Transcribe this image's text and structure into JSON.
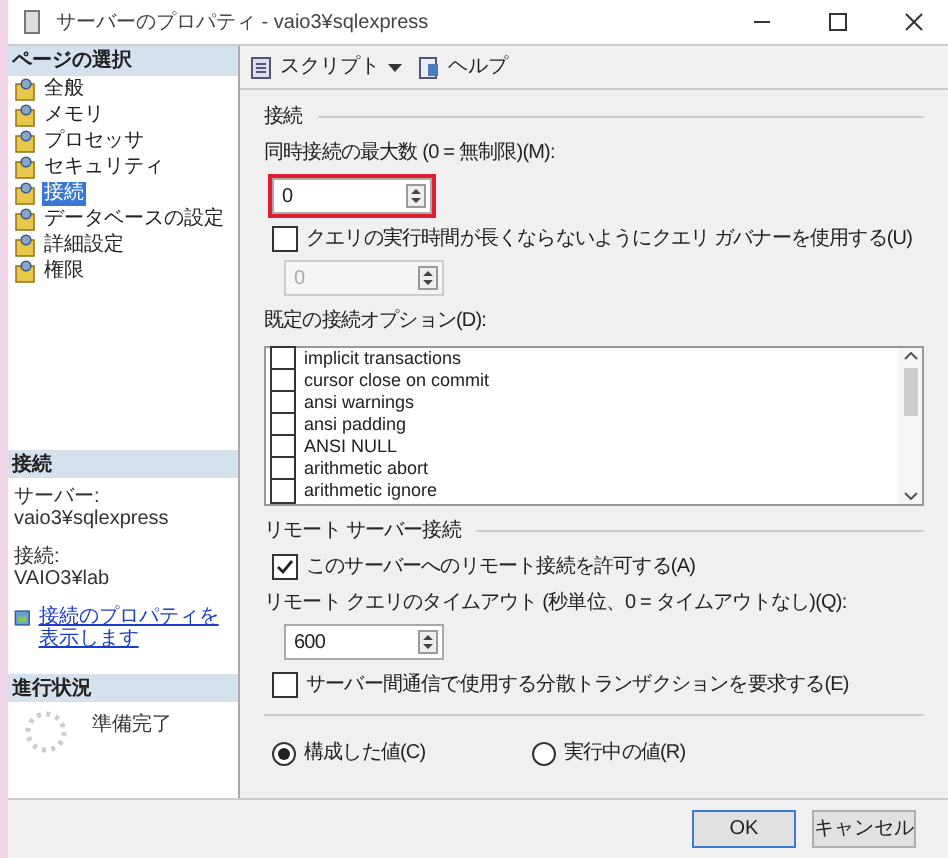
{
  "window": {
    "title": "サーバーのプロパティ - vaio3¥sqlexpress"
  },
  "sidebar": {
    "heading": "ページの選択",
    "items": [
      {
        "label": "全般",
        "selected": false
      },
      {
        "label": "メモリ",
        "selected": false
      },
      {
        "label": "プロセッサ",
        "selected": false
      },
      {
        "label": "セキュリティ",
        "selected": false
      },
      {
        "label": "接続",
        "selected": true
      },
      {
        "label": "データベースの設定",
        "selected": false
      },
      {
        "label": "詳細設定",
        "selected": false
      },
      {
        "label": "権限",
        "selected": false
      }
    ]
  },
  "connection_info": {
    "heading": "接続",
    "server_label": "サーバー:",
    "server": "vaio3¥sqlexpress",
    "connection_label": "接続:",
    "connection": "VAIO3¥lab",
    "link": "接続のプロパティを表示します"
  },
  "progress": {
    "heading": "進行状況",
    "status": "準備完了"
  },
  "toolbar": {
    "script": "スクリプト",
    "help": "ヘルプ"
  },
  "connections": {
    "heading": "接続",
    "max_label": "同時接続の最大数 (0 = 無制限)(M):",
    "max_value": "0",
    "governor": {
      "label": "クエリの実行時間が長くならないようにクエリ ガバナーを使用する(U)",
      "checked": false
    },
    "governor_value": "0",
    "options_label": "既定の接続オプション(D):",
    "options": [
      {
        "label": "implicit transactions",
        "checked": false
      },
      {
        "label": "cursor close on commit",
        "checked": false
      },
      {
        "label": "ansi warnings",
        "checked": false
      },
      {
        "label": "ansi padding",
        "checked": false
      },
      {
        "label": "ANSI NULL",
        "checked": false
      },
      {
        "label": "arithmetic abort",
        "checked": false
      },
      {
        "label": "arithmetic ignore",
        "checked": false
      }
    ]
  },
  "remote": {
    "heading": "リモート サーバー接続",
    "allow": {
      "label": "このサーバーへのリモート接続を許可する(A)",
      "checked": true
    },
    "timeout_label": "リモート クエリのタイムアウト (秒単位、0 = タイムアウトなし)(Q):",
    "timeout_value": "600",
    "distributed": {
      "label": "サーバー間通信で使用する分散トランザクションを要求する(E)",
      "checked": false
    }
  },
  "value_mode": [
    {
      "label": "構成した値(C)",
      "selected": true
    },
    {
      "label": "実行中の値(R)",
      "selected": false
    }
  ],
  "buttons": [
    "OK",
    "キャンセル"
  ]
}
